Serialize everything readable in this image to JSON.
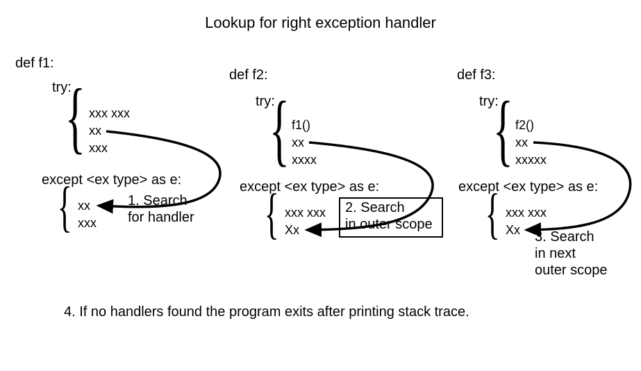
{
  "title": "Lookup for right exception handler",
  "footer": "4. If no handlers found the program exits after printing stack trace.",
  "f1": {
    "def": "def f1:",
    "try": "try:",
    "tryLines": [
      "xxx xxx",
      "xx",
      "xxx"
    ],
    "except": "except <ex type> as e:",
    "exceptLines": [
      "xx",
      "xxx"
    ]
  },
  "f2": {
    "def": "def f2:",
    "try": "try:",
    "tryLines": [
      "f1()",
      "xx",
      "xxxx"
    ],
    "except": "except <ex type> as e:",
    "exceptLines": [
      "xxx xxx",
      "Xx"
    ]
  },
  "f3": {
    "def": "def f3:",
    "try": "try:",
    "tryLines": [
      "f2()",
      "xx",
      "xxxxx"
    ],
    "except": "except <ex type> as e:",
    "exceptLines": [
      "xxx xxx",
      "Xx"
    ]
  },
  "annot1a": "1. Search",
  "annot1b": "for handler",
  "annot2a": "2. Search",
  "annot2b": "in outer scope",
  "annot3a": "3. Search",
  "annot3b": "in next",
  "annot3c": "outer scope"
}
